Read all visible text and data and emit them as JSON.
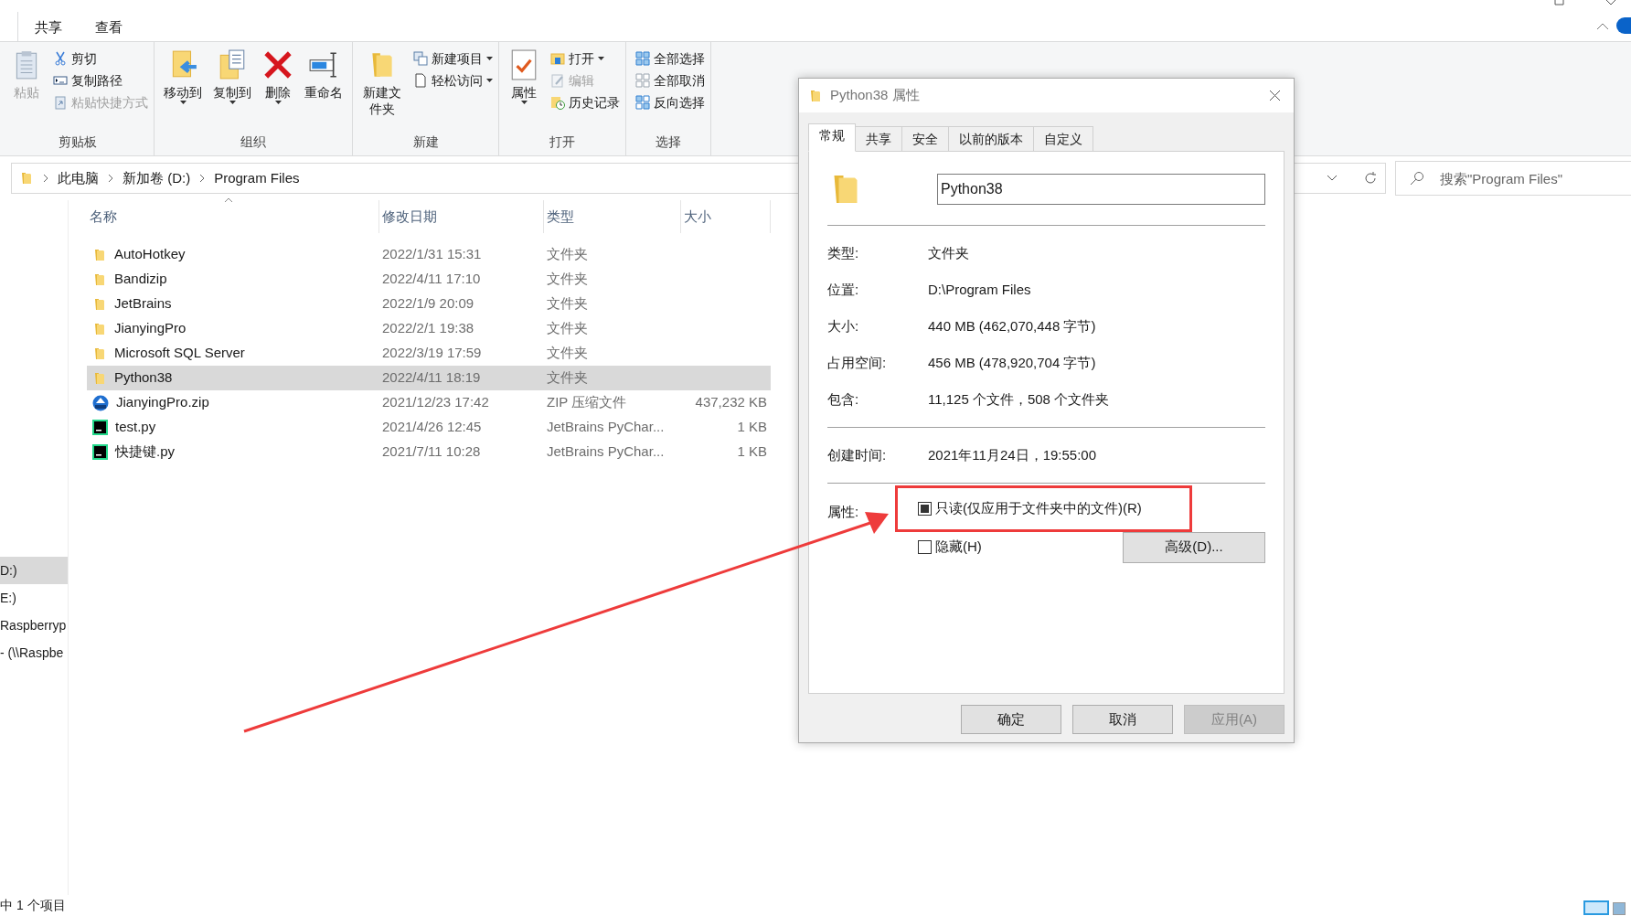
{
  "menu_tabs": [
    {
      "label": "共享"
    },
    {
      "label": "查看"
    }
  ],
  "ribbon": {
    "groups": [
      {
        "label": "剪贴板",
        "items": [
          {
            "kind": "large",
            "label": "粘贴",
            "disabled": true
          },
          {
            "kind": "small",
            "label": "剪切",
            "disabled": false
          },
          {
            "kind": "small",
            "label": "复制路径",
            "disabled": false
          },
          {
            "kind": "small",
            "label": "粘贴快捷方式",
            "disabled": true
          }
        ]
      },
      {
        "label": "组织",
        "items": [
          {
            "kind": "large",
            "label": "移动到",
            "dropdown": true,
            "disabled": false
          },
          {
            "kind": "large",
            "label": "复制到",
            "dropdown": true,
            "disabled": false
          },
          {
            "kind": "large",
            "label": "删除",
            "dropdown": true,
            "disabled": false
          },
          {
            "kind": "large",
            "label": "重命名",
            "dropdown": false,
            "disabled": false
          }
        ]
      },
      {
        "label": "新建",
        "items": [
          {
            "kind": "large",
            "label": "新建文件夹",
            "dropdown": false,
            "disabled": false
          },
          {
            "kind": "small",
            "label": "新建项目",
            "dropdown": true,
            "disabled": false
          },
          {
            "kind": "small",
            "label": "轻松访问",
            "dropdown": true,
            "disabled": false
          }
        ]
      },
      {
        "label": "打开",
        "items": [
          {
            "kind": "large",
            "label": "属性",
            "dropdown": true,
            "disabled": false
          },
          {
            "kind": "small",
            "label": "打开",
            "dropdown": true,
            "disabled": false
          },
          {
            "kind": "small",
            "label": "编辑",
            "dropdown": false,
            "disabled": true
          },
          {
            "kind": "small",
            "label": "历史记录",
            "dropdown": false,
            "disabled": false
          }
        ]
      },
      {
        "label": "选择",
        "items": [
          {
            "kind": "small",
            "label": "全部选择",
            "disabled": false
          },
          {
            "kind": "small",
            "label": "全部取消",
            "disabled": false
          },
          {
            "kind": "small",
            "label": "反向选择",
            "disabled": false
          }
        ]
      }
    ]
  },
  "address": {
    "crumbs": [
      "此电脑",
      "新加卷 (D:)",
      "Program Files"
    ]
  },
  "search": {
    "placeholder": "搜索\"Program Files\""
  },
  "nav": [
    {
      "label": "D:)",
      "selected": true
    },
    {
      "label": "E:)",
      "selected": false
    },
    {
      "label": "Raspberryp",
      "selected": false
    },
    {
      "label": "- (\\\\Raspbe",
      "selected": false
    }
  ],
  "table": {
    "columns": [
      "名称",
      "修改日期",
      "类型",
      "大小"
    ],
    "rows": [
      {
        "kind": "folder",
        "name": "AutoHotkey",
        "date": "2022/1/31 15:31",
        "type": "文件夹",
        "size": "",
        "selected": false
      },
      {
        "kind": "folder",
        "name": "Bandizip",
        "date": "2022/4/11 17:10",
        "type": "文件夹",
        "size": "",
        "selected": false
      },
      {
        "kind": "folder",
        "name": "JetBrains",
        "date": "2022/1/9 20:09",
        "type": "文件夹",
        "size": "",
        "selected": false
      },
      {
        "kind": "folder",
        "name": "JianyingPro",
        "date": "2022/2/1 19:38",
        "type": "文件夹",
        "size": "",
        "selected": false
      },
      {
        "kind": "folder",
        "name": "Microsoft SQL Server",
        "date": "2022/3/19 17:59",
        "type": "文件夹",
        "size": "",
        "selected": false
      },
      {
        "kind": "folder",
        "name": "Python38",
        "date": "2022/4/11 18:19",
        "type": "文件夹",
        "size": "",
        "selected": true
      },
      {
        "kind": "archive",
        "name": "JianyingPro.zip",
        "date": "2021/12/23 17:42",
        "type": "ZIP 压缩文件",
        "size": "437,232 KB",
        "selected": false
      },
      {
        "kind": "script",
        "name": "test.py",
        "date": "2021/4/26 12:45",
        "type": "JetBrains PyChar...",
        "size": "1 KB",
        "selected": false
      },
      {
        "kind": "script",
        "name": "快捷键.py",
        "date": "2021/7/11 10:28",
        "type": "JetBrains PyChar...",
        "size": "1 KB",
        "selected": false
      }
    ]
  },
  "status_bar": {
    "text": "中 1 个项目"
  },
  "dialog": {
    "title": "Python38 属性",
    "tabs": [
      {
        "label": "常规",
        "selected": true
      },
      {
        "label": "共享",
        "selected": false
      },
      {
        "label": "安全",
        "selected": false
      },
      {
        "label": "以前的版本",
        "selected": false
      },
      {
        "label": "自定义",
        "selected": false
      }
    ],
    "name_value": "Python38",
    "info_groups": [
      [
        {
          "label": "类型:",
          "value": "文件夹"
        },
        {
          "label": "位置:",
          "value": "D:\\Program Files"
        },
        {
          "label": "大小:",
          "value": "440 MB (462,070,448 字节)"
        },
        {
          "label": "占用空间:",
          "value": "456 MB (478,920,704 字节)"
        },
        {
          "label": "包含:",
          "value": "11,125 个文件，508 个文件夹"
        }
      ],
      [
        {
          "label": "创建时间:",
          "value": "2021年11月24日，19:55:00"
        }
      ]
    ],
    "attributes_label": "属性:",
    "attributes": [
      {
        "label": "只读(仅应用于文件夹中的文件)(R)",
        "checked": false,
        "mixed": true,
        "highlighted": true
      },
      {
        "label": "隐藏(H)",
        "checked": false,
        "mixed": false,
        "highlighted": false
      }
    ],
    "advanced_button": "高级(D)...",
    "buttons": [
      {
        "label": "确定",
        "disabled": false
      },
      {
        "label": "取消",
        "disabled": false
      },
      {
        "label": "应用(A)",
        "disabled": true
      }
    ]
  }
}
